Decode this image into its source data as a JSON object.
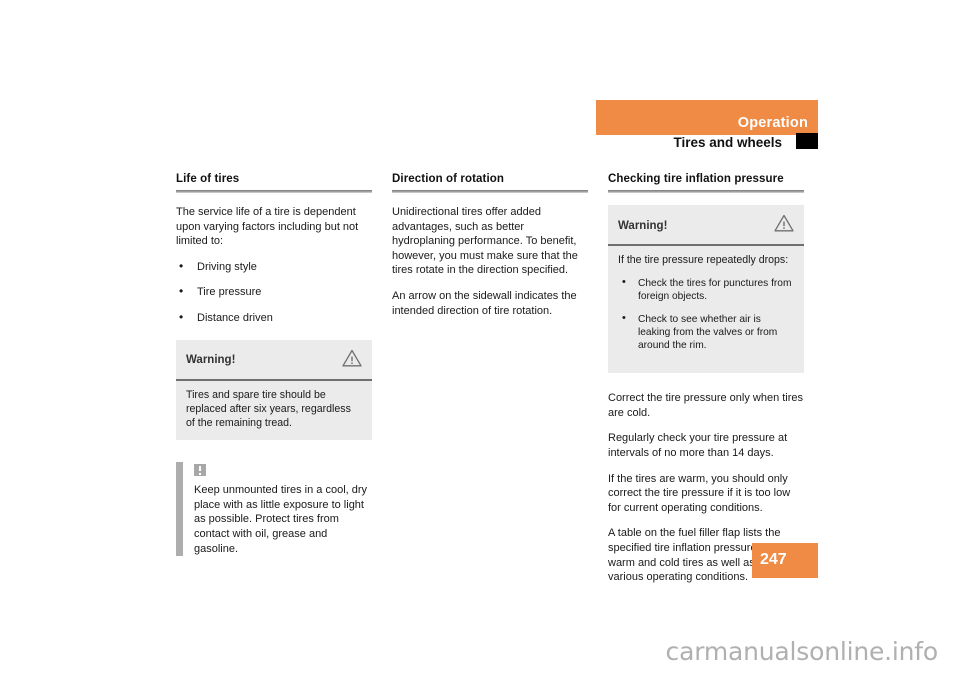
{
  "header": {
    "section_title": "Operation",
    "chapter_title": "Tires and wheels",
    "accent_color": "#ef8b44",
    "marker_color": "#000000"
  },
  "columns": [
    {
      "heading": "Life of tires",
      "blocks": [
        {
          "type": "paragraph",
          "text": "The service life of a tire is dependent upon varying factors including but not limited to:"
        },
        {
          "type": "bullets",
          "items": [
            "Driving style",
            "Tire pressure",
            "Distance driven"
          ]
        },
        {
          "type": "warning",
          "title": "Warning!",
          "icon": "warning-triangle-icon",
          "text": "Tires and spare tire should be replaced after six years, regardless of the remaining tread."
        },
        {
          "type": "note",
          "icon": "note-exclamation-icon",
          "text": "Keep unmounted tires in a cool, dry place with as little exposure to light as possible. Protect tires from contact with oil, grease and gasoline."
        }
      ]
    },
    {
      "heading": "Direction of rotation",
      "blocks": [
        {
          "type": "paragraph",
          "text": "Unidirectional tires offer added advantages, such as better hydroplaning performance. To benefit, however, you must make sure that the tires rotate in the direction specified."
        },
        {
          "type": "paragraph",
          "text": "An arrow on the sidewall indicates the intended direction of tire rotation."
        }
      ]
    },
    {
      "heading": "Checking tire inflation pressure",
      "blocks": [
        {
          "type": "warning_list",
          "title": "Warning!",
          "icon": "warning-triangle-icon",
          "intro": "If the tire pressure repeatedly drops:",
          "items": [
            "Check the tires for punctures from foreign objects.",
            "Check to see whether air is leaking from the valves or from around the rim."
          ]
        },
        {
          "type": "paragraph",
          "text": "Correct the tire pressure only when tires are cold."
        },
        {
          "type": "paragraph",
          "text": "Regularly check your tire pressure at intervals of no more than 14 days."
        },
        {
          "type": "paragraph",
          "text": "If the tires are warm, you should only correct the tire pressure if it is too low for current operating conditions."
        },
        {
          "type": "paragraph",
          "text": "A table on the fuel filler flap lists the specified tire inflation pressures for warm and cold tires as well as for various operating conditions."
        }
      ]
    }
  ],
  "footer": {
    "page_number": "247",
    "watermark": "carmanualsonline.info"
  }
}
